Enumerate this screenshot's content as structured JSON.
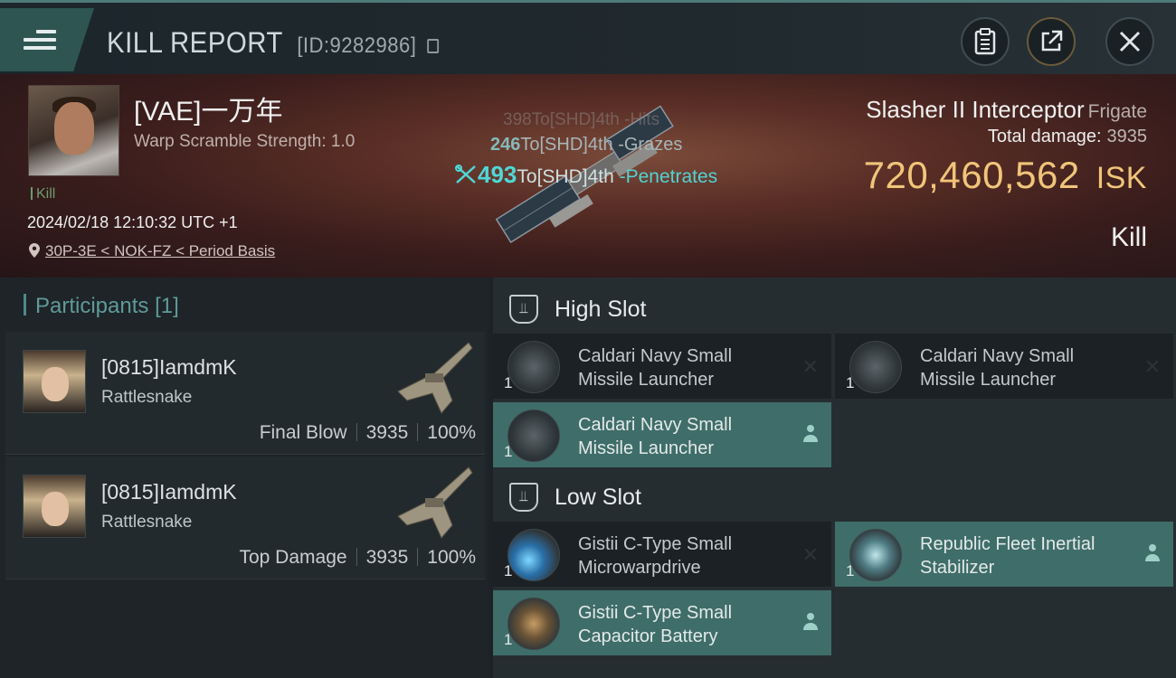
{
  "header": {
    "title": "KILL REPORT",
    "id_text": "[ID:9282986]",
    "buttons": [
      "clipboard-icon",
      "share-icon",
      "close-icon"
    ]
  },
  "victim": {
    "pilot": "[VAE]一万年",
    "warp_scramble": "Warp Scramble Strength: 1.0",
    "kill_label": "Kill",
    "datetime": "2024/02/18 12:10:32 UTC +1",
    "location": "30P-3E < NOK-FZ < Period Basis",
    "ship": "Slasher II Interceptor",
    "ship_class": "Frigate",
    "total_damage_label": "Total damage:",
    "total_damage": "3935",
    "isk_value": "720,460,562",
    "isk_unit": "ISK",
    "result": "Kill"
  },
  "damage_feed": [
    {
      "amount": "398",
      "text": "To[SHD]4th -Hits"
    },
    {
      "amount": "246",
      "text": "To[SHD]4th -Grazes"
    },
    {
      "amount": "493",
      "text": "To[SHD]4th",
      "suffix": " -Penetrates"
    }
  ],
  "participants": {
    "label": "Participants",
    "count": "[1]",
    "items": [
      {
        "name": "[0815]IamdmK",
        "ship": "Rattlesnake",
        "role": "Final Blow",
        "damage": "3935",
        "percent": "100%"
      },
      {
        "name": "[0815]IamdmK",
        "ship": "Rattlesnake",
        "role": "Top Damage",
        "damage": "3935",
        "percent": "100%"
      }
    ]
  },
  "slots": {
    "high": {
      "label": "High Slot",
      "modules": [
        {
          "line1": "Caldari Navy Small",
          "line2": "Missile Launcher",
          "qty": "1",
          "state": "destroyed"
        },
        {
          "line1": "Caldari Navy Small",
          "line2": "Missile Launcher",
          "qty": "1",
          "state": "destroyed"
        },
        {
          "line1": "Caldari Navy Small",
          "line2": "Missile Launcher",
          "qty": "1",
          "state": "dropped"
        }
      ]
    },
    "low": {
      "label": "Low Slot",
      "modules": [
        {
          "line1": "Gistii C-Type Small",
          "line2": "Microwarpdrive",
          "qty": "1",
          "state": "destroyed"
        },
        {
          "line1": "Republic Fleet Inertial",
          "line2": "Stabilizer",
          "qty": "1",
          "state": "dropped"
        },
        {
          "line1": "Gistii C-Type Small",
          "line2": "Capacitor Battery",
          "qty": "1",
          "state": "dropped"
        }
      ]
    }
  },
  "colors": {
    "accent_teal": "#3f6d69",
    "isk_gold": "#f1c57a",
    "penetrate_cyan": "#4fd7d7"
  }
}
